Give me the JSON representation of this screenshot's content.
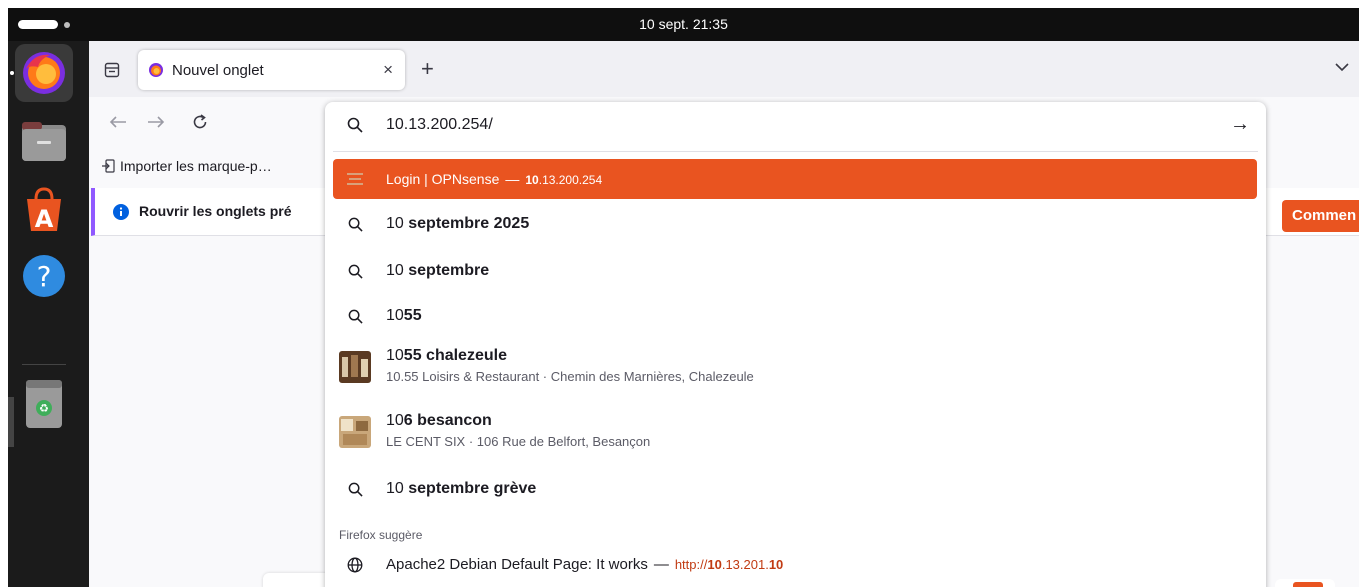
{
  "topbar": {
    "clock": "10 sept.  21:35"
  },
  "dock": {
    "items": [
      {
        "name": "firefox",
        "icon": "firefox-icon"
      },
      {
        "name": "files",
        "icon": "folder-icon"
      },
      {
        "name": "app-center",
        "icon": "app-center-icon"
      },
      {
        "name": "help",
        "icon": "help-icon"
      },
      {
        "name": "trash",
        "icon": "trash-icon"
      }
    ]
  },
  "browser": {
    "tab": {
      "title": "Nouvel onglet",
      "close": "×"
    },
    "new_tab": "+",
    "bookmarks": {
      "import_label": "Importer les marque-p…"
    },
    "notification": {
      "text": "Rouvrir les onglets pré",
      "button": "Commen"
    }
  },
  "urlbar": {
    "value": "10.13.200.254/",
    "go": "→",
    "results": {
      "opnsense": {
        "title": "Login | OPNsense",
        "sep": "—",
        "url_bold": "10",
        "url_rest": ".13.200.254"
      },
      "s1": {
        "prefix": "10 ",
        "bold": "septembre 2025"
      },
      "s2": {
        "prefix": "10 ",
        "bold": "septembre"
      },
      "s3": {
        "prefix": "10",
        "bold": "55"
      },
      "place1": {
        "prefix": "10",
        "bold": "55 chalezeule",
        "sub": "10.55 Loisirs & Restaurant · Chemin des Marnières, Chalezeule"
      },
      "place2": {
        "prefix": "10",
        "bold": "6 besancon",
        "sub": "LE CENT SIX · 106 Rue de Belfort, Besançon"
      },
      "s4": {
        "prefix": "10 ",
        "bold": "septembre grève"
      },
      "group_label": "Firefox suggère",
      "apache": {
        "title": "Apache2 Debian Default Page: It works",
        "sep": "—",
        "url_a": "http://",
        "url_b": "10",
        "url_c": ".13.201.",
        "url_d": "10"
      }
    }
  },
  "colors": {
    "accent": "#e95420",
    "notification_bar": "#9059ff"
  }
}
